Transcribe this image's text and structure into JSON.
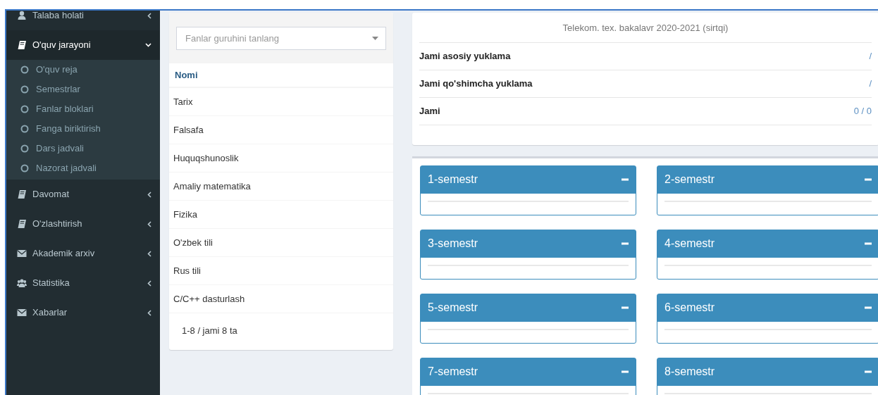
{
  "sidebar": {
    "items": [
      {
        "label": "Talaba holati",
        "selected": false,
        "expanded": false
      },
      {
        "label": "O'quv jarayoni",
        "selected": true,
        "expanded": true,
        "children": [
          {
            "label": "O'quv reja",
            "selected": false
          },
          {
            "label": "Semestrlar",
            "selected": false
          },
          {
            "label": "Fanlar bloklari",
            "selected": false
          },
          {
            "label": "Fanga biriktirish",
            "selected": false
          },
          {
            "label": "Dars jadvali",
            "selected": false
          },
          {
            "label": "Nazorat jadvali",
            "selected": false
          }
        ]
      },
      {
        "label": "Davomat",
        "selected": false,
        "expanded": false
      },
      {
        "label": "O'zlashtirish",
        "selected": false,
        "expanded": false
      },
      {
        "label": "Akademik arxiv",
        "selected": false,
        "expanded": false
      },
      {
        "label": "Statistika",
        "selected": false,
        "expanded": false
      },
      {
        "label": "Xabarlar",
        "selected": false,
        "expanded": false
      }
    ]
  },
  "subjects": {
    "select": {
      "placeholder": "Fanlar guruhini tanlang"
    },
    "table": {
      "columns": [
        "Nomi"
      ],
      "rows": [
        [
          "Tarix"
        ],
        [
          "Falsafa"
        ],
        [
          "Huquqshunoslik"
        ],
        [
          "Amaliy matematika"
        ],
        [
          "Fizika"
        ],
        [
          "O'zbek tili"
        ],
        [
          "Rus tili"
        ],
        [
          "C/C++ dasturlash"
        ]
      ]
    },
    "pagination": "1-8 / jami 8 ta"
  },
  "summary": {
    "title": "Telekom. tex. bakalavr 2020-2021 (sirtqi)",
    "rows": [
      {
        "label": "Jami asosiy yuklama",
        "value": "/"
      },
      {
        "label": "Jami qo'shimcha yuklama",
        "value": "/"
      },
      {
        "label": "Jami",
        "value": "0 / 0"
      }
    ]
  },
  "semesters": [
    {
      "title": "1-semestr",
      "expanded": true
    },
    {
      "title": "2-semestr",
      "expanded": true
    },
    {
      "title": "3-semestr",
      "expanded": true
    },
    {
      "title": "4-semestr",
      "expanded": true
    },
    {
      "title": "5-semestr",
      "expanded": true
    },
    {
      "title": "6-semestr",
      "expanded": true
    },
    {
      "title": "7-semestr",
      "expanded": true
    },
    {
      "title": "8-semestr",
      "expanded": true
    }
  ]
}
